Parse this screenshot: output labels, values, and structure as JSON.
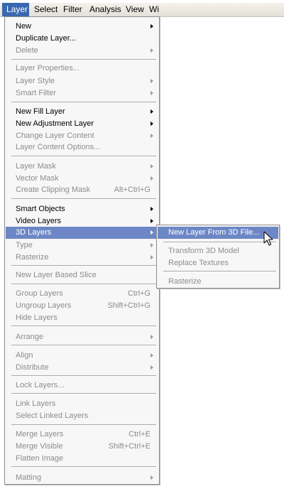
{
  "menubar": {
    "items": [
      {
        "label": "Layer",
        "active": true
      },
      {
        "label": "Select"
      },
      {
        "label": "Filter"
      },
      {
        "label": "Analysis"
      },
      {
        "label": "View"
      },
      {
        "label": "Wi"
      }
    ]
  },
  "layer_menu": {
    "items": [
      {
        "label": "New",
        "submenu": true
      },
      {
        "label": "Duplicate Layer..."
      },
      {
        "label": "Delete",
        "disabled": true,
        "submenu": true
      },
      {
        "label": "Layer Properties...",
        "disabled": true
      },
      {
        "label": "Layer Style",
        "disabled": true,
        "submenu": true
      },
      {
        "label": "Smart Filter",
        "disabled": true,
        "submenu": true
      },
      {
        "label": "New Fill Layer",
        "submenu": true
      },
      {
        "label": "New Adjustment Layer",
        "submenu": true
      },
      {
        "label": "Change Layer Content",
        "disabled": true,
        "submenu": true
      },
      {
        "label": "Layer Content Options...",
        "disabled": true
      },
      {
        "label": "Layer Mask",
        "disabled": true,
        "submenu": true
      },
      {
        "label": "Vector Mask",
        "disabled": true,
        "submenu": true
      },
      {
        "label": "Create Clipping Mask",
        "disabled": true,
        "shortcut": "Alt+Ctrl+G"
      },
      {
        "label": "Smart Objects",
        "submenu": true
      },
      {
        "label": "Video Layers",
        "submenu": true
      },
      {
        "label": "3D Layers",
        "submenu": true,
        "highlighted": true
      },
      {
        "label": "Type",
        "disabled": true,
        "submenu": true
      },
      {
        "label": "Rasterize",
        "disabled": true,
        "submenu": true
      },
      {
        "label": "New Layer Based Slice",
        "disabled": true
      },
      {
        "label": "Group Layers",
        "disabled": true,
        "shortcut": "Ctrl+G"
      },
      {
        "label": "Ungroup Layers",
        "disabled": true,
        "shortcut": "Shift+Ctrl+G"
      },
      {
        "label": "Hide Layers",
        "disabled": true
      },
      {
        "label": "Arrange",
        "disabled": true,
        "submenu": true
      },
      {
        "label": "Align",
        "disabled": true,
        "submenu": true
      },
      {
        "label": "Distribute",
        "disabled": true,
        "submenu": true
      },
      {
        "label": "Lock Layers...",
        "disabled": true
      },
      {
        "label": "Link Layers",
        "disabled": true
      },
      {
        "label": "Select Linked Layers",
        "disabled": true
      },
      {
        "label": "Merge Layers",
        "disabled": true,
        "shortcut": "Ctrl+E"
      },
      {
        "label": "Merge Visible",
        "disabled": true,
        "shortcut": "Shift+Ctrl+E"
      },
      {
        "label": "Flatten Image",
        "disabled": true
      },
      {
        "label": "Matting",
        "disabled": true,
        "submenu": true
      }
    ]
  },
  "submenu_3d": {
    "items": [
      {
        "label": "New Layer From 3D File...",
        "highlighted": true
      },
      {
        "label": "Transform 3D Model",
        "disabled": true
      },
      {
        "label": "Replace Textures",
        "disabled": true
      },
      {
        "label": "Rasterize",
        "disabled": true
      }
    ]
  },
  "icons": {
    "cursor": "arrow-pointer-icon",
    "submenu_indicator": "triangle-right-icon"
  }
}
